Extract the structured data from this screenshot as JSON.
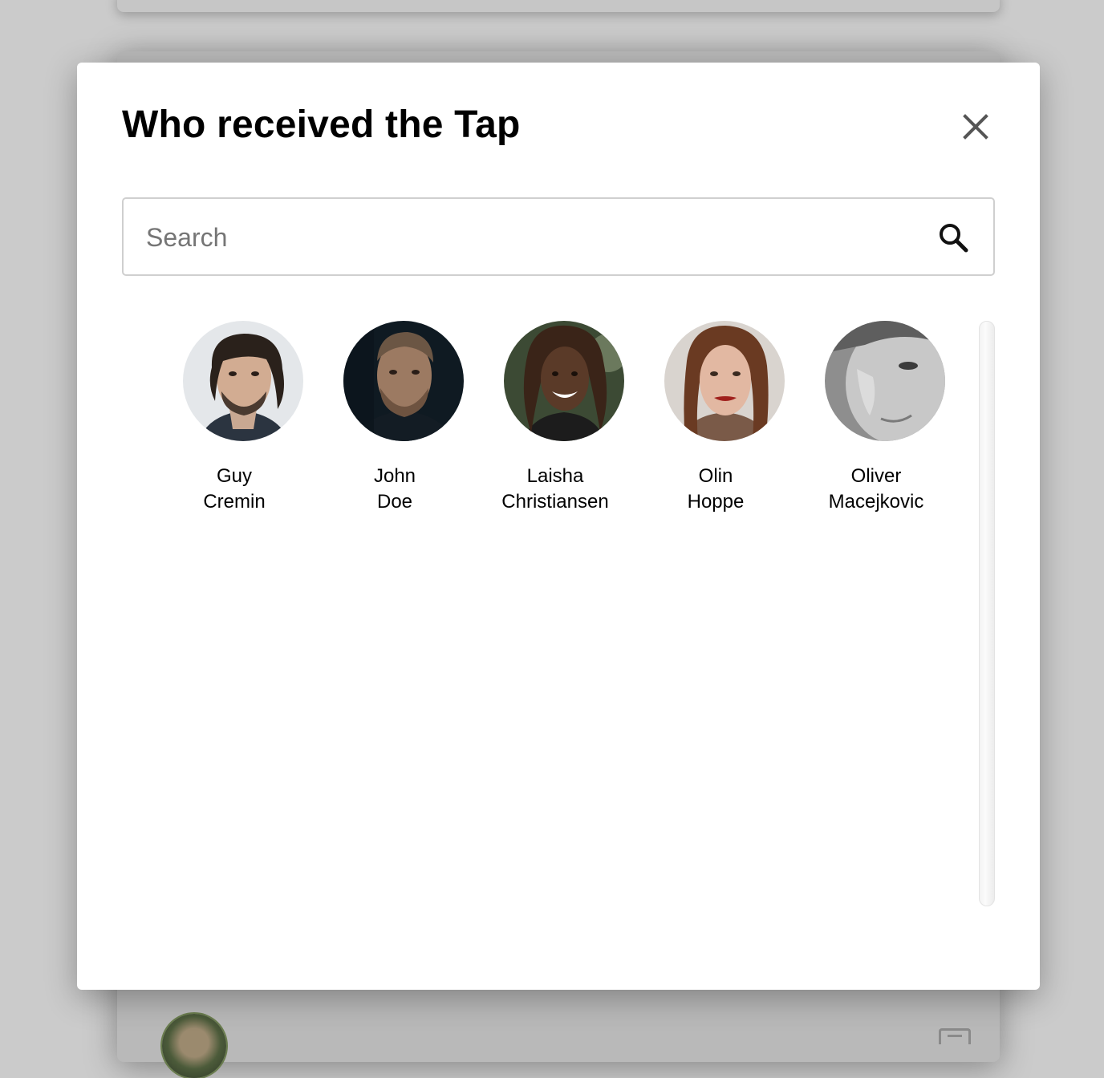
{
  "modal": {
    "title": "Who received the Tap",
    "close_icon": "close-icon"
  },
  "search": {
    "placeholder": "Search",
    "value": "",
    "icon": "search-icon"
  },
  "people": [
    {
      "name": "Guy\nCremin"
    },
    {
      "name": "John\nDoe"
    },
    {
      "name": "Laisha\nChristiansen"
    },
    {
      "name": "Olin\nHoppe"
    },
    {
      "name": "Oliver\nMacejkovic"
    }
  ],
  "colors": {
    "overlay": "#cbcbcb",
    "modal_bg": "#ffffff",
    "border": "#cfcfcf",
    "text": "#000000",
    "placeholder": "#757575"
  }
}
